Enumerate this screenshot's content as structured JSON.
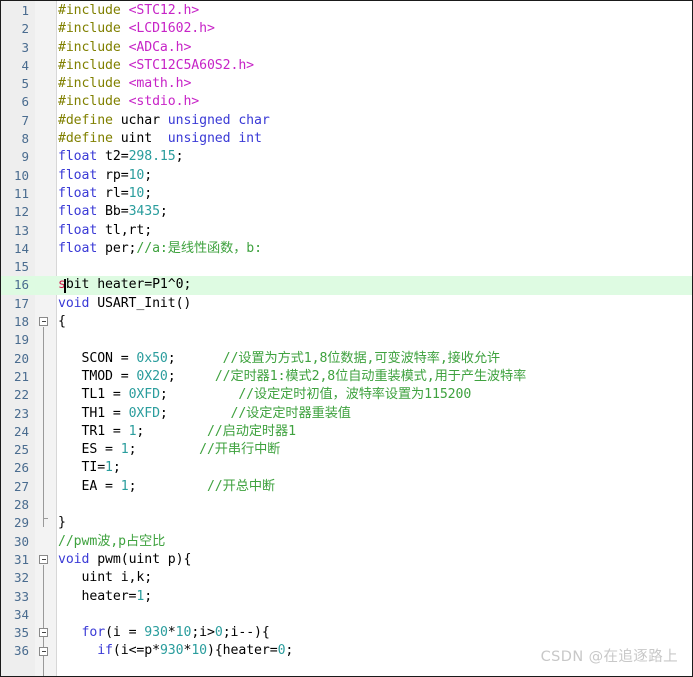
{
  "editor": {
    "language": "C",
    "current_line": 16,
    "cursor_column": 2,
    "first_visible_line": 1,
    "last_visible_line": 36,
    "colors": {
      "background": "#ffffff",
      "gutter": "#eeeeee",
      "line_number": "#4a6c8f",
      "current_line_highlight": "#defbe2",
      "preprocessor": "#808000",
      "header_name": "#c724c7",
      "keyword": "#3a3ad6",
      "number": "#2a9d9d",
      "comment": "#3fa23f",
      "error": "#d21a4b",
      "plain_text": "#000000"
    }
  },
  "watermark": {
    "text": "CSDN @在追逐路上"
  },
  "lines": [
    {
      "n": "1",
      "text": "#include <STC12.h>"
    },
    {
      "n": "2",
      "text": "#include <LCD1602.h>"
    },
    {
      "n": "3",
      "text": "#include <ADCa.h>"
    },
    {
      "n": "4",
      "text": "#include <STC12C5A60S2.h>"
    },
    {
      "n": "5",
      "text": "#include <math.h>"
    },
    {
      "n": "6",
      "text": "#include <stdio.h>"
    },
    {
      "n": "7",
      "text": "#define uchar unsigned char"
    },
    {
      "n": "8",
      "text": "#define uint  unsigned int"
    },
    {
      "n": "9",
      "text": "float t2=298.15;"
    },
    {
      "n": "10",
      "text": "float rp=10;"
    },
    {
      "n": "11",
      "text": "float rl=10;"
    },
    {
      "n": "12",
      "text": "float Bb=3435;"
    },
    {
      "n": "13",
      "text": "float tl,rt;"
    },
    {
      "n": "14",
      "text": "float per;//a:是线性函数，b:"
    },
    {
      "n": "15",
      "text": ""
    },
    {
      "n": "16",
      "text": "sbit heater=P1^0;"
    },
    {
      "n": "17",
      "text": "void USART_Init()"
    },
    {
      "n": "18",
      "text": "{"
    },
    {
      "n": "19",
      "text": ""
    },
    {
      "n": "20",
      "text": "   SCON = 0x50;      //设置为方式1,8位数据,可变波特率,接收允许"
    },
    {
      "n": "21",
      "text": "   TMOD = 0X20;     //定时器1:模式2,8位自动重装模式,用于产生波特率"
    },
    {
      "n": "22",
      "text": "   TL1 = 0XFD;         //设定定时初值，波特率设置为115200"
    },
    {
      "n": "23",
      "text": "   TH1 = 0XFD;        //设定定时器重装值"
    },
    {
      "n": "24",
      "text": "   TR1 = 1;        //启动定时器1"
    },
    {
      "n": "25",
      "text": "   ES = 1;        //开串行中断"
    },
    {
      "n": "26",
      "text": "   TI=1;"
    },
    {
      "n": "27",
      "text": "   EA = 1;         //开总中断"
    },
    {
      "n": "28",
      "text": ""
    },
    {
      "n": "29",
      "text": "}"
    },
    {
      "n": "30",
      "text": "//pwm波,p占空比"
    },
    {
      "n": "31",
      "text": "void pwm(uint p){"
    },
    {
      "n": "32",
      "text": "   uint i,k;"
    },
    {
      "n": "33",
      "text": "   heater=1;"
    },
    {
      "n": "34",
      "text": ""
    },
    {
      "n": "35",
      "text": "   for(i = 930*10;i>0;i--){"
    },
    {
      "n": "36",
      "text": "     if(i<=p*930*10){heater=0;"
    }
  ],
  "tokens": {
    "1": [
      {
        "t": "#include ",
        "c": "pp"
      },
      {
        "t": "<STC12.h>",
        "c": "hdr"
      }
    ],
    "2": [
      {
        "t": "#include ",
        "c": "pp"
      },
      {
        "t": "<LCD1602.h>",
        "c": "hdr"
      }
    ],
    "3": [
      {
        "t": "#include ",
        "c": "pp"
      },
      {
        "t": "<ADCa.h>",
        "c": "hdr"
      }
    ],
    "4": [
      {
        "t": "#include ",
        "c": "pp"
      },
      {
        "t": "<STC12C5A60S2.h>",
        "c": "hdr"
      }
    ],
    "5": [
      {
        "t": "#include ",
        "c": "pp"
      },
      {
        "t": "<math.h>",
        "c": "hdr"
      }
    ],
    "6": [
      {
        "t": "#include ",
        "c": "pp"
      },
      {
        "t": "<stdio.h>",
        "c": "hdr"
      }
    ],
    "7": [
      {
        "t": "#define ",
        "c": "pp"
      },
      {
        "t": "uchar ",
        "c": "plain"
      },
      {
        "t": "unsigned char",
        "c": "kw"
      }
    ],
    "8": [
      {
        "t": "#define ",
        "c": "pp"
      },
      {
        "t": "uint  ",
        "c": "plain"
      },
      {
        "t": "unsigned int",
        "c": "kw"
      }
    ],
    "9": [
      {
        "t": "float",
        "c": "kw"
      },
      {
        "t": " t2=",
        "c": "plain"
      },
      {
        "t": "298.15",
        "c": "num"
      },
      {
        "t": ";",
        "c": "plain"
      }
    ],
    "10": [
      {
        "t": "float",
        "c": "kw"
      },
      {
        "t": " rp=",
        "c": "plain"
      },
      {
        "t": "10",
        "c": "num"
      },
      {
        "t": ";",
        "c": "plain"
      }
    ],
    "11": [
      {
        "t": "float",
        "c": "kw"
      },
      {
        "t": " rl=",
        "c": "plain"
      },
      {
        "t": "10",
        "c": "num"
      },
      {
        "t": ";",
        "c": "plain"
      }
    ],
    "12": [
      {
        "t": "float",
        "c": "kw"
      },
      {
        "t": " Bb=",
        "c": "plain"
      },
      {
        "t": "3435",
        "c": "num"
      },
      {
        "t": ";",
        "c": "plain"
      }
    ],
    "13": [
      {
        "t": "float",
        "c": "kw"
      },
      {
        "t": " tl,rt;",
        "c": "plain"
      }
    ],
    "14": [
      {
        "t": "float",
        "c": "kw"
      },
      {
        "t": " per;",
        "c": "plain"
      },
      {
        "t": "//a:是线性函数，b:",
        "c": "cmt"
      }
    ],
    "15": [],
    "16": [
      {
        "t": "s",
        "c": "err"
      },
      {
        "t": "bit",
        "c": "plain"
      },
      {
        "t": " heater=P1^0;",
        "c": "plain"
      }
    ],
    "17": [
      {
        "t": "void",
        "c": "kw"
      },
      {
        "t": " USART_Init()",
        "c": "plain"
      }
    ],
    "18": [
      {
        "t": "{",
        "c": "plain"
      }
    ],
    "19": [],
    "20": [
      {
        "t": "   SCON = ",
        "c": "plain"
      },
      {
        "t": "0x50",
        "c": "num"
      },
      {
        "t": ";      ",
        "c": "plain"
      },
      {
        "t": "//设置为方式1,8位数据,可变波特率,接收允许",
        "c": "cmt"
      }
    ],
    "21": [
      {
        "t": "   TMOD = ",
        "c": "plain"
      },
      {
        "t": "0X20",
        "c": "num"
      },
      {
        "t": ";     ",
        "c": "plain"
      },
      {
        "t": "//定时器1:模式2,8位自动重装模式,用于产生波特率",
        "c": "cmt"
      }
    ],
    "22": [
      {
        "t": "   TL1 = ",
        "c": "plain"
      },
      {
        "t": "0XFD",
        "c": "num"
      },
      {
        "t": ";         ",
        "c": "plain"
      },
      {
        "t": "//设定定时初值，波特率设置为115200",
        "c": "cmt"
      }
    ],
    "23": [
      {
        "t": "   TH1 = ",
        "c": "plain"
      },
      {
        "t": "0XFD",
        "c": "num"
      },
      {
        "t": ";        ",
        "c": "plain"
      },
      {
        "t": "//设定定时器重装值",
        "c": "cmt"
      }
    ],
    "24": [
      {
        "t": "   TR1 = ",
        "c": "plain"
      },
      {
        "t": "1",
        "c": "num"
      },
      {
        "t": ";        ",
        "c": "plain"
      },
      {
        "t": "//启动定时器1",
        "c": "cmt"
      }
    ],
    "25": [
      {
        "t": "   ES = ",
        "c": "plain"
      },
      {
        "t": "1",
        "c": "num"
      },
      {
        "t": ";        ",
        "c": "plain"
      },
      {
        "t": "//开串行中断",
        "c": "cmt"
      }
    ],
    "26": [
      {
        "t": "   TI=",
        "c": "plain"
      },
      {
        "t": "1",
        "c": "num"
      },
      {
        "t": ";",
        "c": "plain"
      }
    ],
    "27": [
      {
        "t": "   EA = ",
        "c": "plain"
      },
      {
        "t": "1",
        "c": "num"
      },
      {
        "t": ";         ",
        "c": "plain"
      },
      {
        "t": "//开总中断",
        "c": "cmt"
      }
    ],
    "28": [],
    "29": [
      {
        "t": "}",
        "c": "plain"
      }
    ],
    "30": [
      {
        "t": "//pwm波,p占空比",
        "c": "cmt"
      }
    ],
    "31": [
      {
        "t": "void",
        "c": "kw"
      },
      {
        "t": " pwm(",
        "c": "plain"
      },
      {
        "t": "uint",
        "c": "plain"
      },
      {
        "t": " p){",
        "c": "plain"
      }
    ],
    "32": [
      {
        "t": "   uint i,k;",
        "c": "plain"
      }
    ],
    "33": [
      {
        "t": "   heater=",
        "c": "plain"
      },
      {
        "t": "1",
        "c": "num"
      },
      {
        "t": ";",
        "c": "plain"
      }
    ],
    "34": [],
    "35": [
      {
        "t": "   ",
        "c": "plain"
      },
      {
        "t": "for",
        "c": "kw"
      },
      {
        "t": "(i = ",
        "c": "plain"
      },
      {
        "t": "930",
        "c": "num"
      },
      {
        "t": "*",
        "c": "plain"
      },
      {
        "t": "10",
        "c": "num"
      },
      {
        "t": ";i>",
        "c": "plain"
      },
      {
        "t": "0",
        "c": "num"
      },
      {
        "t": ";i--){",
        "c": "plain"
      }
    ],
    "36": [
      {
        "t": "     ",
        "c": "plain"
      },
      {
        "t": "if",
        "c": "kw"
      },
      {
        "t": "(i<=p*",
        "c": "plain"
      },
      {
        "t": "930",
        "c": "num"
      },
      {
        "t": "*",
        "c": "plain"
      },
      {
        "t": "10",
        "c": "num"
      },
      {
        "t": "){heater=",
        "c": "plain"
      },
      {
        "t": "0",
        "c": "num"
      },
      {
        "t": ";",
        "c": "plain"
      }
    ]
  },
  "fold_markers": [
    {
      "line": 18,
      "state": "expanded"
    },
    {
      "line": 31,
      "state": "expanded"
    },
    {
      "line": 35,
      "state": "expanded"
    },
    {
      "line": 36,
      "state": "expanded"
    }
  ]
}
